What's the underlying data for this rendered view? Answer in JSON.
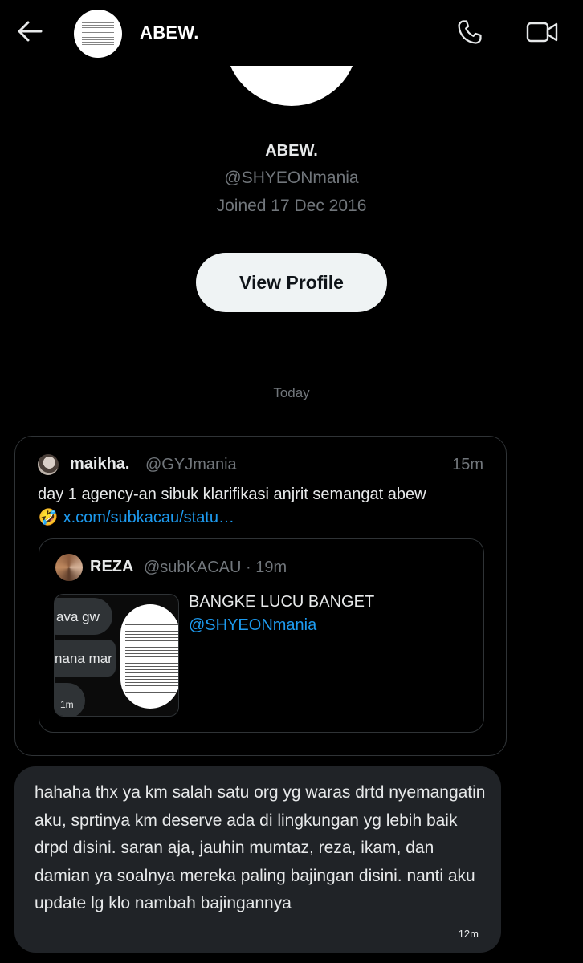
{
  "header": {
    "back_icon": "arrow-left-icon",
    "contact_name": "ABEW.",
    "call_icon": "phone-icon",
    "video_icon": "video-camera-icon"
  },
  "profile": {
    "name": "ABEW.",
    "handle": "@SHYEONmania",
    "joined": "Joined 17 Dec 2016",
    "view_profile_label": "View Profile"
  },
  "conversation": {
    "date_divider": "Today",
    "shared_tweet": {
      "author_name": "maikha.",
      "author_handle": "@GYJmania",
      "time": "15m",
      "text": "day 1 agency-an sibuk klarifikasi anjrit semangat abew",
      "emoji": "🤣",
      "link": "x.com/subkacau/statu…",
      "quote": {
        "author_name": "REZA",
        "author_handle_time": "@subKACAU · 19m",
        "text": "BANGKE LUCU BANGET",
        "mention": "@SHYEONmania",
        "media": {
          "line1": "ava gw",
          "line2": "nana mar",
          "time": "1m"
        }
      }
    },
    "reply": {
      "text": "hahaha thx ya km salah satu org yg waras drtd nyemangatin aku, sprtinya km deserve ada di lingkungan yg lebih baik drpd disini. saran aja, jauhin mumtaz, reza, ikam, dan damian ya soalnya mereka paling bajingan disini. nanti aku update lg klo nambah bajingannya",
      "time": "12m"
    }
  },
  "colors": {
    "background": "#000000",
    "text_primary": "#e7e9ea",
    "text_secondary": "#71767b",
    "link": "#1d9bf0",
    "bubble": "#202327",
    "border": "#2f3336",
    "button_bg": "#eff3f4"
  }
}
